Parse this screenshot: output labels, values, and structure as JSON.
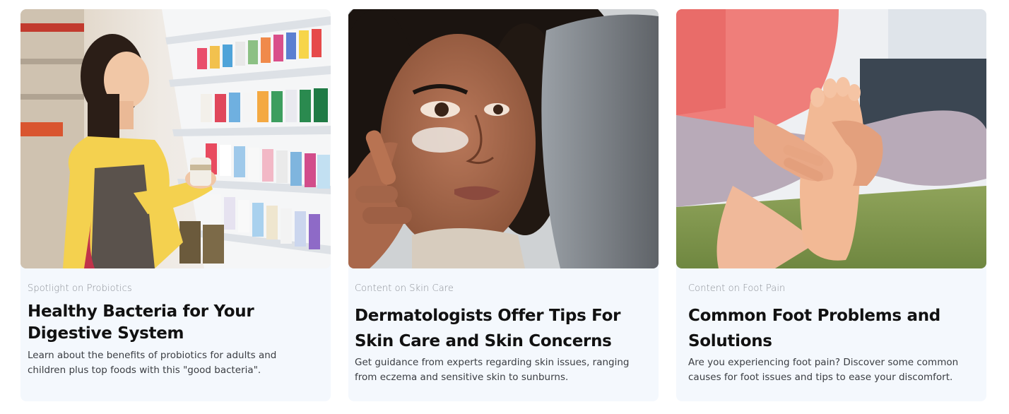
{
  "cards": [
    {
      "eyebrow": "Spotlight on Probiotics",
      "title": "Healthy Bacteria for Your Digestive System",
      "description": "Learn about the benefits of probiotics for adults and children plus top foods with this \"good bacteria\"."
    },
    {
      "eyebrow": "Content on Skin Care",
      "title": "Dermatologists Offer Tips For Skin Care and Skin Concerns",
      "description": "Get guidance from experts regarding skin issues, ranging from eczema and sensitive skin to sunburns."
    },
    {
      "eyebrow": "Content on Foot Pain",
      "title": "Common Foot Problems and Solutions",
      "description": "Are you experiencing foot pain? Discover some common causes for foot issues and tips to ease your discomfort."
    }
  ],
  "colors": {
    "card_background": "#f4f8fd",
    "title_text": "#111111",
    "eyebrow_text": "#8b8f96",
    "body_text": "#3a3d42"
  }
}
